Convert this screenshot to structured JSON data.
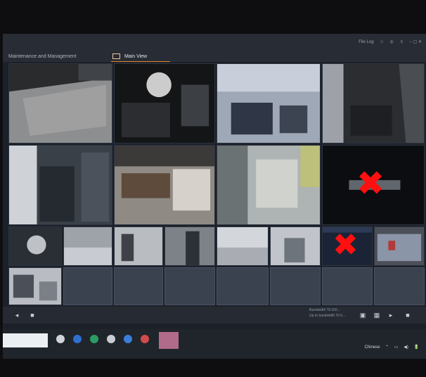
{
  "header": {
    "tabs": [
      {
        "label": "Maintenance and Management"
      },
      {
        "label": "Main View"
      }
    ],
    "right_items": [
      "File Log",
      "□",
      "◎",
      "≡",
      "– ▢ ✕"
    ]
  },
  "cameras": {
    "count_visible": 18,
    "disconnected_marker": "✖"
  },
  "bottombar": {
    "status_line1": "Bandwidth  Tit 160…",
    "status_line2": "Up to bandwidth  Tit 6…"
  },
  "taskbar": {
    "search_placeholder": "",
    "tray_items": [
      "Chinese",
      "⌃",
      "▭",
      "◀)",
      "🔋"
    ],
    "time": "",
    "date": ""
  },
  "colors": {
    "accent": "#e7852b",
    "marker": "#ff1010"
  }
}
